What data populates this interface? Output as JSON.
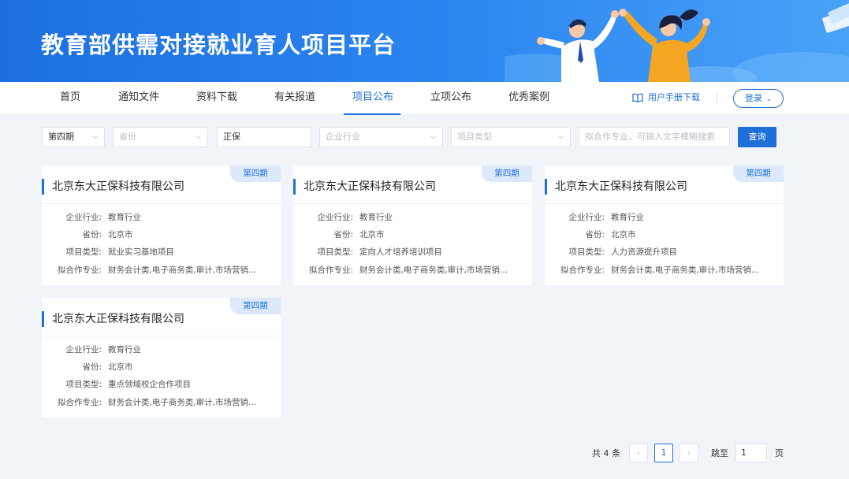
{
  "banner": {
    "title": "教育部供需对接就业育人项目平台"
  },
  "nav": {
    "items": [
      "首页",
      "通知文件",
      "资料下载",
      "有关报道",
      "项目公布",
      "立项公布",
      "优秀案例"
    ],
    "active_index": 4,
    "manual_label": "用户手册下载",
    "login_label": "登录"
  },
  "filters": {
    "period": "第四期",
    "province_placeholder": "省份",
    "keyword": "正保",
    "industry_placeholder": "企业行业",
    "project_type_placeholder": "项目类型",
    "major_placeholder": "拟合作专业，可输入文字模糊搜索",
    "query_label": "查询"
  },
  "field_labels": {
    "industry": "企业行业:",
    "province": "省份:",
    "project_type": "项目类型:",
    "major": "拟合作专业:"
  },
  "cards": [
    {
      "badge": "第四期",
      "company": "北京东大正保科技有限公司",
      "industry": "教育行业",
      "province": "北京市",
      "project_type": "就业实习基地项目",
      "major": "财务会计类,电子商务类,审计,市场营销..."
    },
    {
      "badge": "第四期",
      "company": "北京东大正保科技有限公司",
      "industry": "教育行业",
      "province": "北京市",
      "project_type": "定向人才培养培训项目",
      "major": "财务会计类,电子商务类,审计,市场营销..."
    },
    {
      "badge": "第四期",
      "company": "北京东大正保科技有限公司",
      "industry": "教育行业",
      "province": "北京市",
      "project_type": "人力资源提升项目",
      "major": "财务会计类,电子商务类,审计,市场营销..."
    },
    {
      "badge": "第四期",
      "company": "北京东大正保科技有限公司",
      "industry": "教育行业",
      "province": "北京市",
      "project_type": "重点领域校企合作项目",
      "major": "财务会计类,电子商务类,审计,市场营销..."
    }
  ],
  "pagination": {
    "total": "共 4 条",
    "prev": "‹",
    "current": "1",
    "next": "›",
    "goto_label": "跳至",
    "goto_value": "1",
    "page_label": "页"
  },
  "colors": {
    "accent": "#1f6fd8",
    "banner": "#2c86f0",
    "background": "#f1f4f9"
  }
}
